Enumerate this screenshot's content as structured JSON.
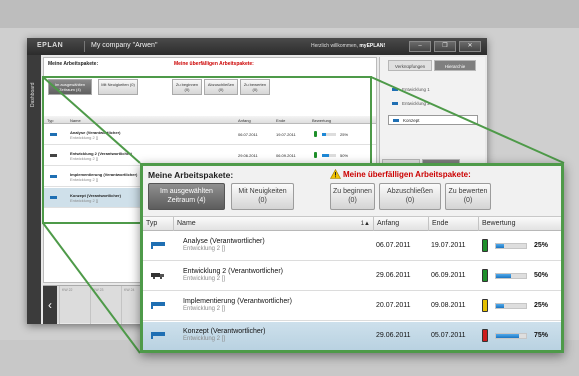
{
  "app": {
    "logo": "EPLAN",
    "company": "My company \"Arwen\"",
    "welcome_text": "Herzlich willkommen,",
    "welcome_user": "myEPLAN!",
    "side_tab": "Dashboard",
    "mini_header": {
      "title": "Meine Arbeitspakete:",
      "warning": "Meine überfälligen Arbeitspakete:",
      "buttons": [
        "Im ausgewählten Zeitraum (4)",
        "Mit Neuigkeiten (0)",
        "Zu beginnen (0)",
        "Abzuschließen (0)",
        "Zu bewerten (0)"
      ]
    },
    "right_panel": {
      "tabs": [
        "Verknüpfungen",
        "Hierarchie"
      ],
      "items": [
        "Entwicklung 1",
        "Entwicklung 2",
        "Konzept"
      ],
      "bottom_tabs": [
        "Allgemein",
        "Bewertung"
      ],
      "bottom_subtabs": [
        "Bewertung",
        "Zustellerwartung"
      ]
    },
    "timeline_labels": [
      "KW 22",
      "KW 23",
      "KW 24",
      "KW 25",
      "KW 26",
      "KW 27",
      "KW 28",
      "KW 29",
      "KW 30",
      "KW 31"
    ]
  },
  "panel": {
    "title": "Meine Arbeitspakete:",
    "warning_title": "Meine überfälligen Arbeitspakete:",
    "warning_icon": "warning-triangle-icon",
    "filters": [
      {
        "line1": "Im ausgewählten",
        "line2": "Zeitraum (4)",
        "active": true
      },
      {
        "line1": "Mit Neuigkeiten",
        "line2": "(0)",
        "active": false
      }
    ],
    "overdue_filters": [
      {
        "line1": "Zu beginnen",
        "line2": "(0)"
      },
      {
        "line1": "Abzuschließen",
        "line2": "(0)"
      },
      {
        "line1": "Zu bewerten",
        "line2": "(0)"
      }
    ],
    "columns": {
      "typ": "Typ",
      "name": "Name",
      "sort_indicator": "1▲",
      "anfang": "Anfang",
      "ende": "Ende",
      "bewertung": "Bewertung"
    },
    "rows": [
      {
        "name": "Analyse (Verantwortlicher)",
        "sub": "Entwicklung 2 []",
        "anfang": "06.07.2011",
        "ende": "19.07.2011",
        "percent_label": "25%",
        "progress": 25,
        "light": "#1e8f2a",
        "type_icon": "flag-icon",
        "selected": false
      },
      {
        "name": "Entwicklung 2 (Verantwortlicher)",
        "sub": "Entwicklung 2 []",
        "anfang": "29.06.2011",
        "ende": "06.09.2011",
        "percent_label": "50%",
        "progress": 50,
        "light": "#1e8f2a",
        "type_icon": "truck-icon",
        "selected": false
      },
      {
        "name": "Implementierung (Verantwortlicher)",
        "sub": "Entwicklung 2 []",
        "anfang": "20.07.2011",
        "ende": "09.08.2011",
        "percent_label": "25%",
        "progress": 25,
        "light": "#e5c000",
        "type_icon": "flag-icon",
        "selected": false
      },
      {
        "name": "Konzept (Verantwortlicher)",
        "sub": "Entwicklung 2 []",
        "anfang": "29.06.2011",
        "ende": "05.07.2011",
        "percent_label": "75%",
        "progress": 75,
        "light": "#cc1b1b",
        "type_icon": "flag-icon",
        "selected": true
      }
    ]
  },
  "colors": {
    "accent_green": "#4e9a49",
    "progress_blue": "#1e88d6",
    "flag_blue": "#1f6fb3",
    "warning_red": "#cc0000"
  }
}
